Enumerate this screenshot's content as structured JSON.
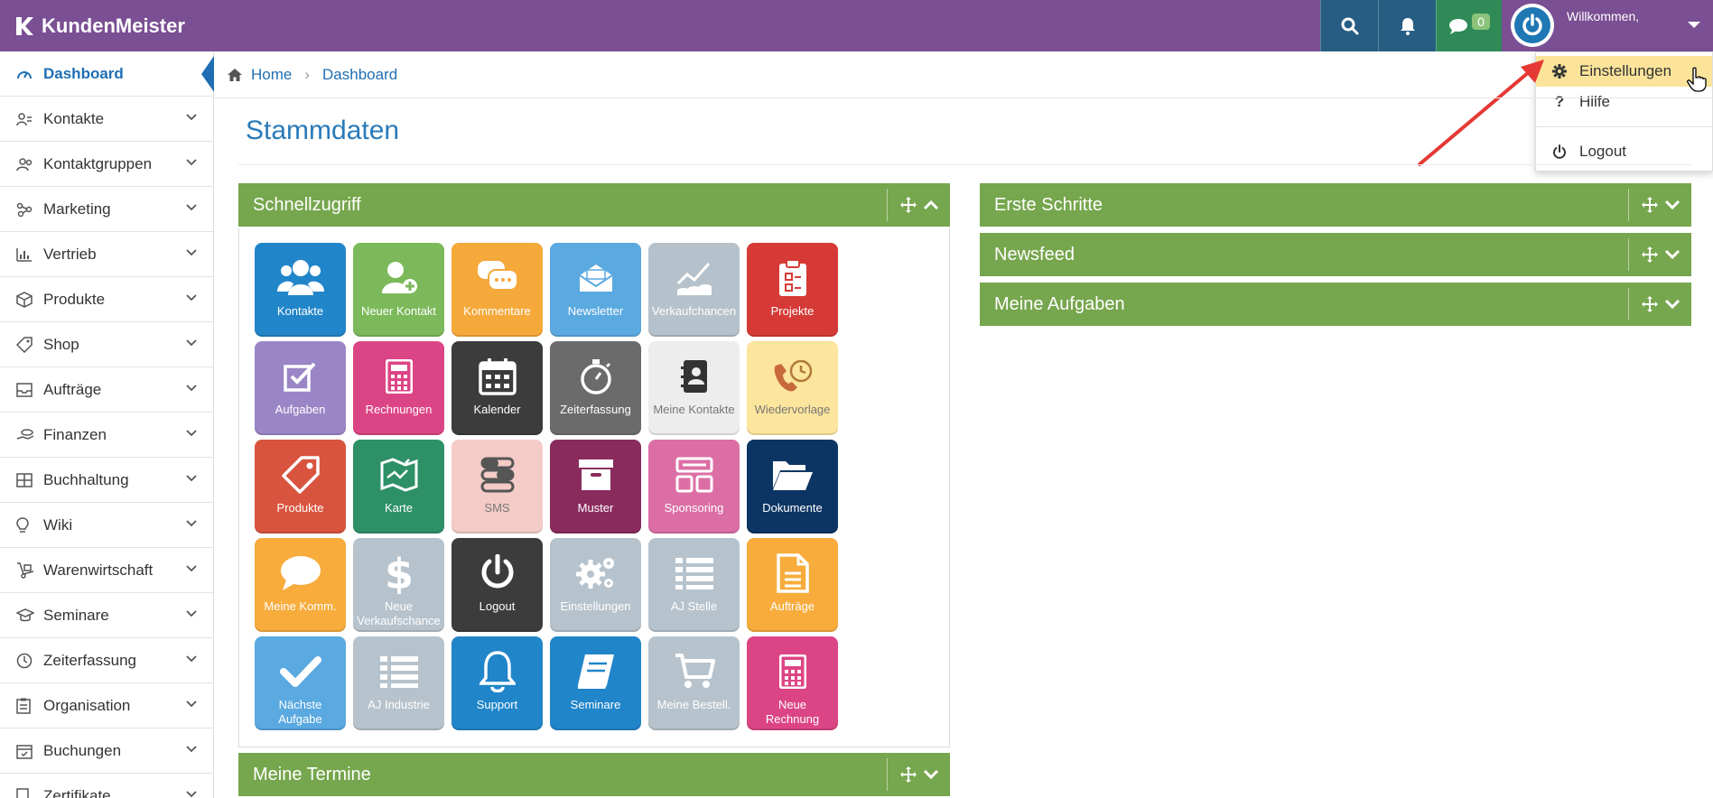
{
  "app": {
    "name": "KundenMeister"
  },
  "header": {
    "chat_count": "0",
    "welcome": "Willkommen,"
  },
  "user_menu": {
    "items": [
      {
        "label": "Einstellungen"
      },
      {
        "label": "Hilfe"
      },
      {
        "label": "Logout"
      }
    ]
  },
  "sidebar": {
    "items": [
      {
        "label": "Dashboard"
      },
      {
        "label": "Kontakte"
      },
      {
        "label": "Kontaktgruppen"
      },
      {
        "label": "Marketing"
      },
      {
        "label": "Vertrieb"
      },
      {
        "label": "Produkte"
      },
      {
        "label": "Shop"
      },
      {
        "label": "Aufträge"
      },
      {
        "label": "Finanzen"
      },
      {
        "label": "Buchhaltung"
      },
      {
        "label": "Wiki"
      },
      {
        "label": "Warenwirtschaft"
      },
      {
        "label": "Seminare"
      },
      {
        "label": "Zeiterfassung"
      },
      {
        "label": "Organisation"
      },
      {
        "label": "Buchungen"
      },
      {
        "label": "Zertifikate"
      }
    ]
  },
  "breadcrumb": {
    "home": "Home",
    "current": "Dashboard"
  },
  "page": {
    "title": "Stammdaten"
  },
  "panels": {
    "schnellzugriff": "Schnellzugriff",
    "meine_termine": "Meine Termine",
    "erste_schritte": "Erste Schritte",
    "newsfeed": "Newsfeed",
    "meine_aufgaben": "Meine Aufgaben"
  },
  "tiles": [
    {
      "label": "Kontakte",
      "color": "#2185c9",
      "icon": "users-icon"
    },
    {
      "label": "Neuer Kontakt",
      "color": "#7cb95a",
      "icon": "add-user-icon"
    },
    {
      "label": "Kommentare",
      "color": "#f5a93a",
      "icon": "comments-icon"
    },
    {
      "label": "Newsletter",
      "color": "#5aa9e0",
      "icon": "newsletter-icon"
    },
    {
      "label": "Verkaufchancen",
      "color": "#b6c2cb",
      "icon": "chart-coins-icon"
    },
    {
      "label": "Projekte",
      "color": "#d63a36",
      "icon": "clipboard-icon"
    },
    {
      "label": "Aufgaben",
      "color": "#9a86c6",
      "icon": "check-square-icon"
    },
    {
      "label": "Rechnungen",
      "color": "#dc4585",
      "icon": "calculator-icon"
    },
    {
      "label": "Kalender",
      "color": "#3c3c3c",
      "icon": "calendar-icon"
    },
    {
      "label": "Zeiterfassung",
      "color": "#6b6b6b",
      "icon": "stopwatch-icon"
    },
    {
      "label": "Meine Kontakte",
      "color": "#ededed",
      "icon": "address-book-icon"
    },
    {
      "label": "Wiedervorlage",
      "color": "#fce59c",
      "icon": "phone-clock-icon"
    },
    {
      "label": "Produkte",
      "color": "#d9543f",
      "icon": "tag-icon"
    },
    {
      "label": "Karte",
      "color": "#2e9067",
      "icon": "map-icon"
    },
    {
      "label": "SMS",
      "color": "#f4cbc6",
      "icon": "sms-icon"
    },
    {
      "label": "Muster",
      "color": "#8a2b5e",
      "icon": "archive-icon"
    },
    {
      "label": "Sponsoring",
      "color": "#db6fa5",
      "icon": "layout-icon"
    },
    {
      "label": "Dokumente",
      "color": "#0c3563",
      "icon": "folder-open-icon"
    },
    {
      "label": "Meine Komm.",
      "color": "#f7ac3c",
      "icon": "comment-icon"
    },
    {
      "label": "Neue Verkaufschance",
      "color": "#b7c3cc",
      "icon": "dollar-icon"
    },
    {
      "label": "Logout",
      "color": "#3c3c3c",
      "icon": "power-icon"
    },
    {
      "label": "Einstellungen",
      "color": "#b7c3cc",
      "icon": "gears-icon"
    },
    {
      "label": "AJ Stelle",
      "color": "#b7c3cc",
      "icon": "list-icon"
    },
    {
      "label": "Aufträge",
      "color": "#f7ac3c",
      "icon": "document-icon"
    },
    {
      "label": "Nächste Aufgabe",
      "color": "#5aa9e0",
      "icon": "checkmark-icon"
    },
    {
      "label": "AJ Industrie",
      "color": "#b7c3cc",
      "icon": "list-icon"
    },
    {
      "label": "Support",
      "color": "#2185c9",
      "icon": "bell-icon"
    },
    {
      "label": "Seminare",
      "color": "#2185c9",
      "icon": "book-icon"
    },
    {
      "label": "Meine Bestell.",
      "color": "#b7c3cc",
      "icon": "cart-icon"
    },
    {
      "label": "Neue Rechnung",
      "color": "#dc4585",
      "icon": "calculator-icon"
    }
  ],
  "colors": {
    "header": "#7a4f93",
    "accent": "#1f6eb3",
    "panel": "#76a64d",
    "highlight": "#fbe49a"
  }
}
